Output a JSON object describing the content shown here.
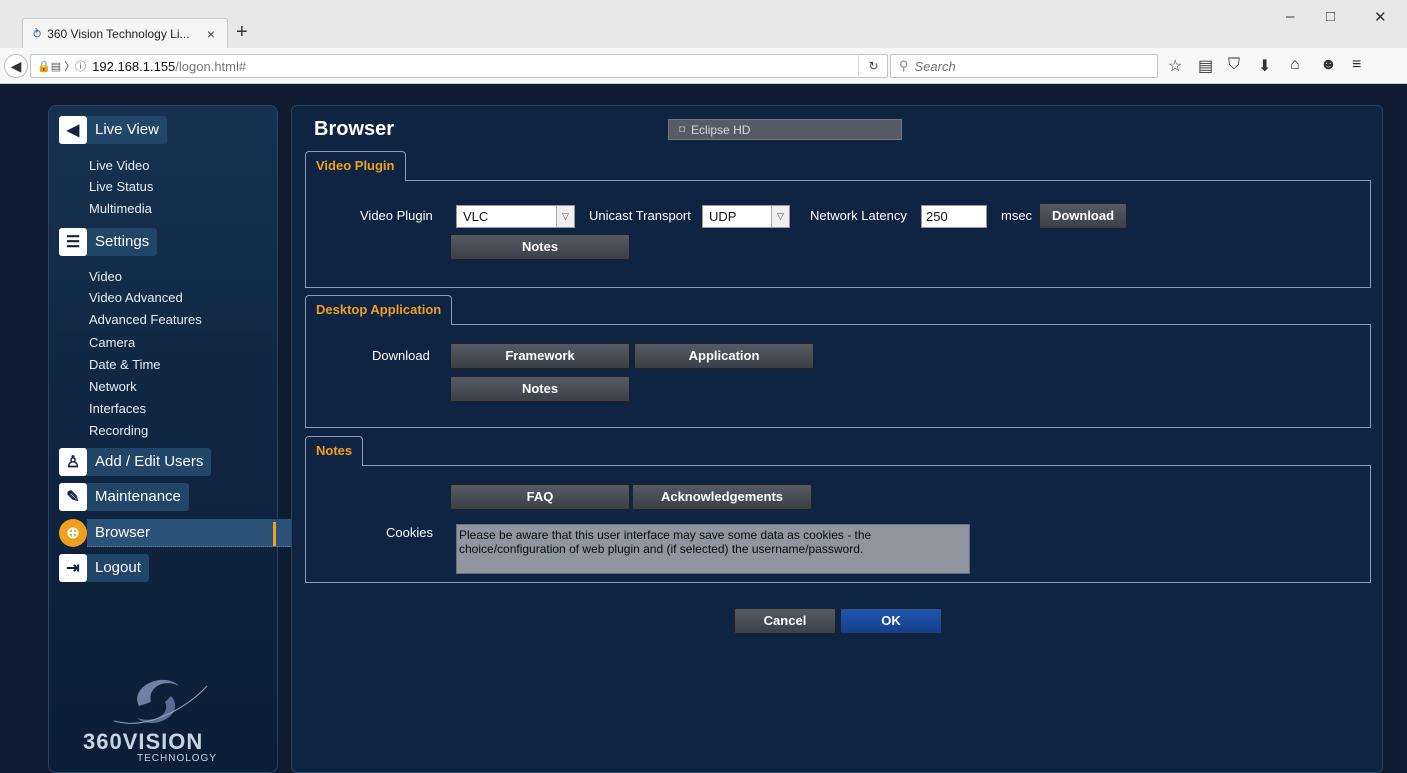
{
  "browser": {
    "tab_title": "360 Vision Technology Li...",
    "tab_close": "×",
    "new_tab": "+",
    "url_host": "192.168.1.155",
    "url_path": "/logon.html#",
    "search_placeholder": "Search",
    "window_controls": {
      "minimize": "–",
      "maximize": "□",
      "close": "✕"
    },
    "toolbar_icons": [
      "☆",
      "▤",
      "⛉",
      "⬇",
      "⌂",
      "☻",
      "≡"
    ]
  },
  "sidebar": {
    "sections": [
      {
        "label": "Live View",
        "icon": "camera-icon",
        "glyph": "◀"
      },
      {
        "label": "Settings",
        "icon": "sliders-icon",
        "glyph": "☰"
      },
      {
        "label": "Add / Edit Users",
        "icon": "add-user-icon",
        "glyph": "♙"
      },
      {
        "label": "Maintenance",
        "icon": "wrench-icon",
        "glyph": "✎"
      },
      {
        "label": "Browser",
        "icon": "globe-icon",
        "glyph": "⊕"
      },
      {
        "label": "Logout",
        "icon": "logout-icon",
        "glyph": "⇥"
      }
    ],
    "live_view_items": [
      "Live Video",
      "Live Status",
      "Multimedia"
    ],
    "settings_items": [
      "Video",
      "Video Advanced",
      "Advanced Features",
      "Camera",
      "Date & Time",
      "Network",
      "Interfaces",
      "Recording"
    ],
    "active_section": "Browser",
    "logo_main": "360VISION",
    "logo_sub": "TECHNOLOGY"
  },
  "main": {
    "title": "Browser",
    "device_name": "Eclipse HD",
    "video_plugin": {
      "tab_label": "Video Plugin",
      "plugin_label": "Video Plugin",
      "plugin_value": "VLC",
      "transport_label": "Unicast Transport",
      "transport_value": "UDP",
      "latency_label": "Network Latency",
      "latency_value": "250",
      "latency_unit": "msec",
      "download_label": "Download",
      "notes_label": "Notes"
    },
    "desktop_app": {
      "tab_label": "Desktop Application",
      "download_label": "Download",
      "framework_label": "Framework",
      "application_label": "Application",
      "notes_label": "Notes"
    },
    "notes": {
      "tab_label": "Notes",
      "faq_label": "FAQ",
      "ack_label": "Acknowledgements",
      "cookies_label": "Cookies",
      "cookies_text": "Please be aware that this user interface may save some data as cookies - the choice/configuration of web plugin and (if selected) the username/password."
    },
    "cancel_label": "Cancel",
    "ok_label": "OK"
  },
  "colors": {
    "accent": "#f0a020",
    "ok_button": "#1a4ea0",
    "background": "#0e1b30"
  }
}
